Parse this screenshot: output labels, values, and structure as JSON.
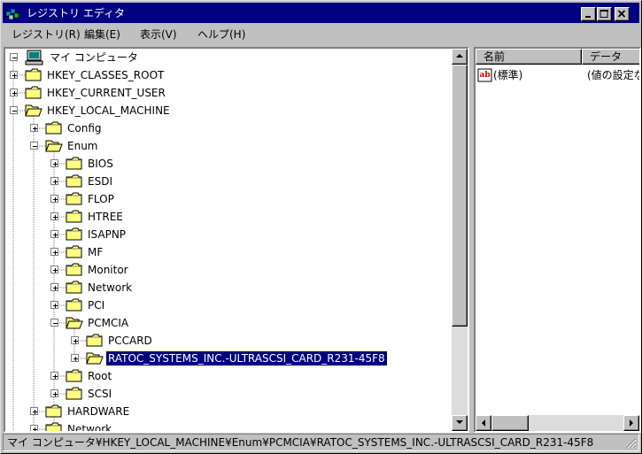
{
  "window": {
    "title": "レジストリ エディタ"
  },
  "menu": [
    {
      "label": "レジストリ(R)"
    },
    {
      "label": "編集(E)"
    },
    {
      "label": "表示(V)"
    },
    {
      "label": "ヘルプ(H)"
    }
  ],
  "tree": {
    "root": "マイ コンピュータ",
    "nodes": [
      {
        "label": "HKEY_CLASSES_ROOT",
        "state": "collapsed"
      },
      {
        "label": "HKEY_CURRENT_USER",
        "state": "collapsed"
      },
      {
        "label": "HKEY_LOCAL_MACHINE",
        "state": "expanded"
      },
      {
        "label": "Config",
        "state": "collapsed"
      },
      {
        "label": "Enum",
        "state": "expanded"
      },
      {
        "label": "BIOS",
        "state": "collapsed"
      },
      {
        "label": "ESDI",
        "state": "collapsed"
      },
      {
        "label": "FLOP",
        "state": "collapsed"
      },
      {
        "label": "HTREE",
        "state": "collapsed"
      },
      {
        "label": "ISAPNP",
        "state": "collapsed"
      },
      {
        "label": "MF",
        "state": "collapsed"
      },
      {
        "label": "Monitor",
        "state": "collapsed"
      },
      {
        "label": "Network",
        "state": "collapsed"
      },
      {
        "label": "PCI",
        "state": "collapsed"
      },
      {
        "label": "PCMCIA",
        "state": "expanded"
      },
      {
        "label": "PCCARD",
        "state": "collapsed"
      },
      {
        "label": "RATOC_SYSTEMS_INC.-ULTRASCSI_CARD_R231-45F8",
        "state": "collapsed",
        "selected": true
      },
      {
        "label": "Root",
        "state": "collapsed"
      },
      {
        "label": "SCSI",
        "state": "collapsed"
      },
      {
        "label": "HARDWARE",
        "state": "collapsed"
      },
      {
        "label": "Network",
        "state": "collapsed"
      }
    ]
  },
  "values": {
    "columns": {
      "name": "名前",
      "data": "データ"
    },
    "rows": [
      {
        "name": "(標準)",
        "data": "(値の設定なし)",
        "type_icon": "ab-string-icon"
      }
    ]
  },
  "status": {
    "path": "マイ コンピュータ¥HKEY_LOCAL_MACHINE¥Enum¥PCMCIA¥RATOC_SYSTEMS_INC.-ULTRASCSI_CARD_R231-45F8"
  },
  "colors": {
    "title_bar": "#000080",
    "selection": "#000080",
    "face": "#c0c0c0",
    "folder": "#ffff80"
  }
}
